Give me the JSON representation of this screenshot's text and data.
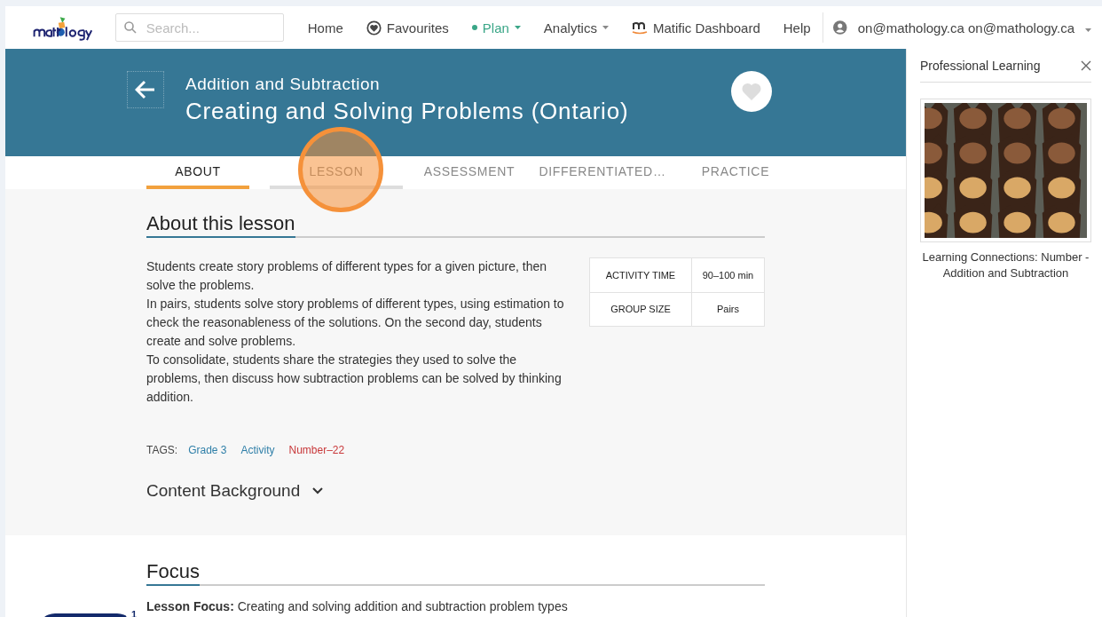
{
  "nav": {
    "search": {
      "placeholder": "Search..."
    },
    "items": [
      {
        "label": "Home",
        "kind": "plain",
        "selected": false,
        "dropdown": false
      },
      {
        "label": "Favourites",
        "kind": "heart",
        "selected": false,
        "dropdown": false
      },
      {
        "label": "Plan",
        "kind": "dot",
        "selected": true,
        "dropdown": true
      },
      {
        "label": "Analytics",
        "kind": "plain",
        "selected": false,
        "dropdown": true
      },
      {
        "label": "Matific Dashboard",
        "kind": "matific",
        "selected": false,
        "dropdown": false
      },
      {
        "label": "Help",
        "kind": "plain",
        "selected": false,
        "dropdown": false
      }
    ],
    "user": "on@mathology.ca on@mathology.ca"
  },
  "banner": {
    "subtitle": "Addition and Subtraction",
    "title": "Creating and Solving Problems (Ontario)",
    "favourite": false
  },
  "tabs": [
    {
      "label": "ABOUT",
      "selected": true,
      "focused": false
    },
    {
      "label": "LESSON",
      "selected": false,
      "focused": true
    },
    {
      "label": "ASSESSMENT",
      "selected": false,
      "focused": false
    },
    {
      "label": "DIFFERENTIATED…",
      "selected": false,
      "focused": false
    },
    {
      "label": "PRACTICE",
      "selected": false,
      "focused": false
    }
  ],
  "about": {
    "heading": "About this lesson",
    "paragraphs": [
      "Students create story problems of different types for a given picture, then solve the problems.",
      "In pairs, students solve story problems of different types, using estimation to check the reasonableness of the solutions. On the second day, students create and solve problems.",
      "To consolidate, students share the strategies they used to solve the problems, then discuss how subtraction problems can be solved by thinking addition."
    ],
    "facts": [
      {
        "label": "ACTIVITY TIME",
        "value": "90–100 min"
      },
      {
        "label": "GROUP SIZE",
        "value": "Pairs"
      }
    ],
    "tags_label": "TAGS:",
    "tags": [
      {
        "label": "Grade 3",
        "color": "#2f7fa8"
      },
      {
        "label": "Activity",
        "color": "#2f7fa8"
      },
      {
        "label": "Number–22",
        "color": "#c8383a"
      }
    ],
    "content_background": {
      "label": "Content Background",
      "expanded": false
    }
  },
  "focus": {
    "heading": "Focus",
    "text": "**Lesson Focus:** Creating and solving addition and subtraction problem types"
  },
  "chat_badge": "1",
  "sidebar": {
    "title": "Professional Learning",
    "card": {
      "kind": "picture",
      "caption": "Learning Connections: Number - Addition and Subtraction"
    }
  }
}
